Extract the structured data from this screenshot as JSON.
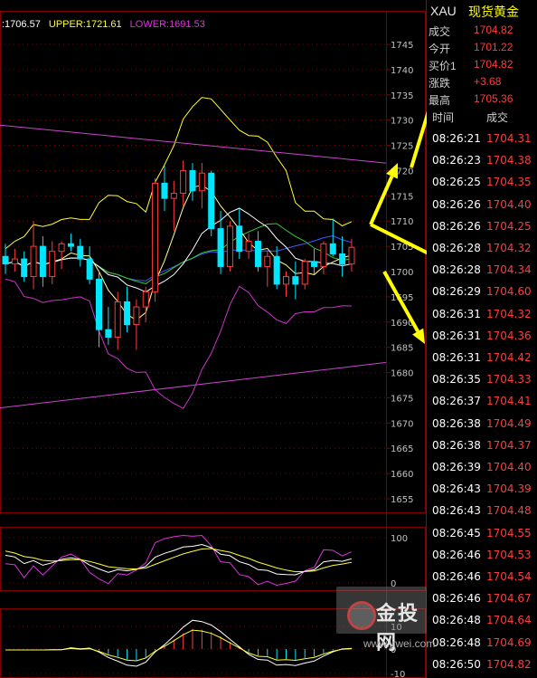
{
  "legend": {
    "mid": ":1706.57",
    "upper": "UPPER:1721.61",
    "lower": "LOWER:1691.53"
  },
  "colors": {
    "up": "#ff3b3b",
    "down": "#00e6ff",
    "grid": "#800000",
    "upper": "#ffff33",
    "lower": "#cc33cc",
    "mid": "#ffffff",
    "trend": "#cc44cc"
  },
  "price_axis": [
    "1745",
    "1740",
    "1735",
    "1730",
    "1725",
    "1720",
    "1715",
    "1710",
    "1705",
    "1700",
    "1695",
    "1690",
    "1685",
    "1680",
    "1675",
    "1670",
    "1665",
    "1660",
    "1655"
  ],
  "osc1_axis": [
    "100",
    "0"
  ],
  "osc2_axis": [
    "10",
    "0",
    "-10"
  ],
  "header": {
    "code": "XAU",
    "name": "现货黄金"
  },
  "quote": [
    {
      "k": "成交",
      "v": "1704.82"
    },
    {
      "k": "今开",
      "v": "1701.22"
    },
    {
      "k": "买价1",
      "v": "1704.82"
    },
    {
      "k": "涨跌",
      "v": "+3.68"
    },
    {
      "k": "最高",
      "v": "1705.36"
    }
  ],
  "ticks_header": {
    "time": "时间",
    "price": "成交"
  },
  "ticks": [
    {
      "t": "08:26:21",
      "p": "1704.31"
    },
    {
      "t": "08:26:23",
      "p": "1704.38"
    },
    {
      "t": "08:26:25",
      "p": "1704.35"
    },
    {
      "t": "08:26:26",
      "p": "1704.40"
    },
    {
      "t": "08:26:26",
      "p": "1704.25"
    },
    {
      "t": "08:26:28",
      "p": "1704.32"
    },
    {
      "t": "08:26:28",
      "p": "1704.34"
    },
    {
      "t": "08:26:29",
      "p": "1704.60"
    },
    {
      "t": "08:26:31",
      "p": "1704.32"
    },
    {
      "t": "08:26:31",
      "p": "1704.36"
    },
    {
      "t": "08:26:31",
      "p": "1704.42"
    },
    {
      "t": "08:26:35",
      "p": "1704.33"
    },
    {
      "t": "08:26:37",
      "p": "1704.41"
    },
    {
      "t": "08:26:38",
      "p": "1704.49"
    },
    {
      "t": "08:26:38",
      "p": "1704.37"
    },
    {
      "t": "08:26:39",
      "p": "1704.40"
    },
    {
      "t": "08:26:43",
      "p": "1704.39"
    },
    {
      "t": "08:26:43",
      "p": "1704.48"
    },
    {
      "t": "08:26:45",
      "p": "1704.55"
    },
    {
      "t": "08:26:46",
      "p": "1704.53"
    },
    {
      "t": "08:26:46",
      "p": "1704.54"
    },
    {
      "t": "08:26:46",
      "p": "1704.67"
    },
    {
      "t": "08:26:48",
      "p": "1704.64"
    },
    {
      "t": "08:26:48",
      "p": "1704.69"
    },
    {
      "t": "08:26:50",
      "p": "1704.82"
    }
  ],
  "candles": [
    {
      "o": 1703.0,
      "h": 1705.5,
      "l": 1699.5,
      "c": 1701.5
    },
    {
      "o": 1701.5,
      "h": 1704.5,
      "l": 1700.0,
      "c": 1702.5
    },
    {
      "o": 1702.5,
      "h": 1704.0,
      "l": 1698.0,
      "c": 1699.0
    },
    {
      "o": 1699.0,
      "h": 1710.0,
      "l": 1696.5,
      "c": 1705.0
    },
    {
      "o": 1705.0,
      "h": 1707.0,
      "l": 1697.0,
      "c": 1699.0
    },
    {
      "o": 1699.0,
      "h": 1706.0,
      "l": 1697.5,
      "c": 1704.0
    },
    {
      "o": 1704.0,
      "h": 1706.0,
      "l": 1700.5,
      "c": 1705.5
    },
    {
      "o": 1705.5,
      "h": 1707.5,
      "l": 1704.0,
      "c": 1705.0
    },
    {
      "o": 1705.0,
      "h": 1706.5,
      "l": 1701.0,
      "c": 1702.5
    },
    {
      "o": 1702.5,
      "h": 1705.0,
      "l": 1697.5,
      "c": 1698.5
    },
    {
      "o": 1698.5,
      "h": 1700.0,
      "l": 1685.0,
      "c": 1688.5
    },
    {
      "o": 1688.5,
      "h": 1693.0,
      "l": 1685.5,
      "c": 1687.0
    },
    {
      "o": 1687.0,
      "h": 1696.0,
      "l": 1684.5,
      "c": 1694.0
    },
    {
      "o": 1694.0,
      "h": 1697.0,
      "l": 1688.0,
      "c": 1689.5
    },
    {
      "o": 1689.5,
      "h": 1694.5,
      "l": 1684.5,
      "c": 1693.0
    },
    {
      "o": 1693.0,
      "h": 1697.0,
      "l": 1690.0,
      "c": 1696.0
    },
    {
      "o": 1696.0,
      "h": 1718.5,
      "l": 1694.0,
      "c": 1717.5
    },
    {
      "o": 1717.5,
      "h": 1721.0,
      "l": 1712.0,
      "c": 1714.5
    },
    {
      "o": 1714.5,
      "h": 1718.0,
      "l": 1708.0,
      "c": 1715.5
    },
    {
      "o": 1715.5,
      "h": 1722.0,
      "l": 1713.0,
      "c": 1720.0
    },
    {
      "o": 1720.0,
      "h": 1721.5,
      "l": 1714.0,
      "c": 1716.0
    },
    {
      "o": 1716.0,
      "h": 1721.5,
      "l": 1712.5,
      "c": 1719.5
    },
    {
      "o": 1719.5,
      "h": 1720.0,
      "l": 1707.0,
      "c": 1708.5
    },
    {
      "o": 1708.5,
      "h": 1712.0,
      "l": 1699.5,
      "c": 1701.0
    },
    {
      "o": 1701.0,
      "h": 1710.0,
      "l": 1700.0,
      "c": 1709.0
    },
    {
      "o": 1709.0,
      "h": 1712.5,
      "l": 1702.5,
      "c": 1704.0
    },
    {
      "o": 1704.0,
      "h": 1707.5,
      "l": 1702.5,
      "c": 1706.0
    },
    {
      "o": 1706.0,
      "h": 1708.0,
      "l": 1700.0,
      "c": 1701.0
    },
    {
      "o": 1701.0,
      "h": 1704.0,
      "l": 1697.0,
      "c": 1703.0
    },
    {
      "o": 1703.0,
      "h": 1705.0,
      "l": 1696.5,
      "c": 1697.5
    },
    {
      "o": 1697.5,
      "h": 1700.0,
      "l": 1695.0,
      "c": 1699.0
    },
    {
      "o": 1699.0,
      "h": 1702.0,
      "l": 1694.5,
      "c": 1697.5
    },
    {
      "o": 1697.5,
      "h": 1702.5,
      "l": 1696.5,
      "c": 1702.0
    },
    {
      "o": 1702.0,
      "h": 1704.5,
      "l": 1699.5,
      "c": 1701.0
    },
    {
      "o": 1701.0,
      "h": 1706.0,
      "l": 1699.5,
      "c": 1705.5
    },
    {
      "o": 1705.5,
      "h": 1710.5,
      "l": 1703.0,
      "c": 1703.5
    },
    {
      "o": 1703.5,
      "h": 1707.0,
      "l": 1699.0,
      "c": 1701.5
    },
    {
      "o": 1701.5,
      "h": 1706.5,
      "l": 1700.0,
      "c": 1704.8
    }
  ],
  "watermark": {
    "text": "金投网",
    "url": "www.jrwei.com"
  }
}
